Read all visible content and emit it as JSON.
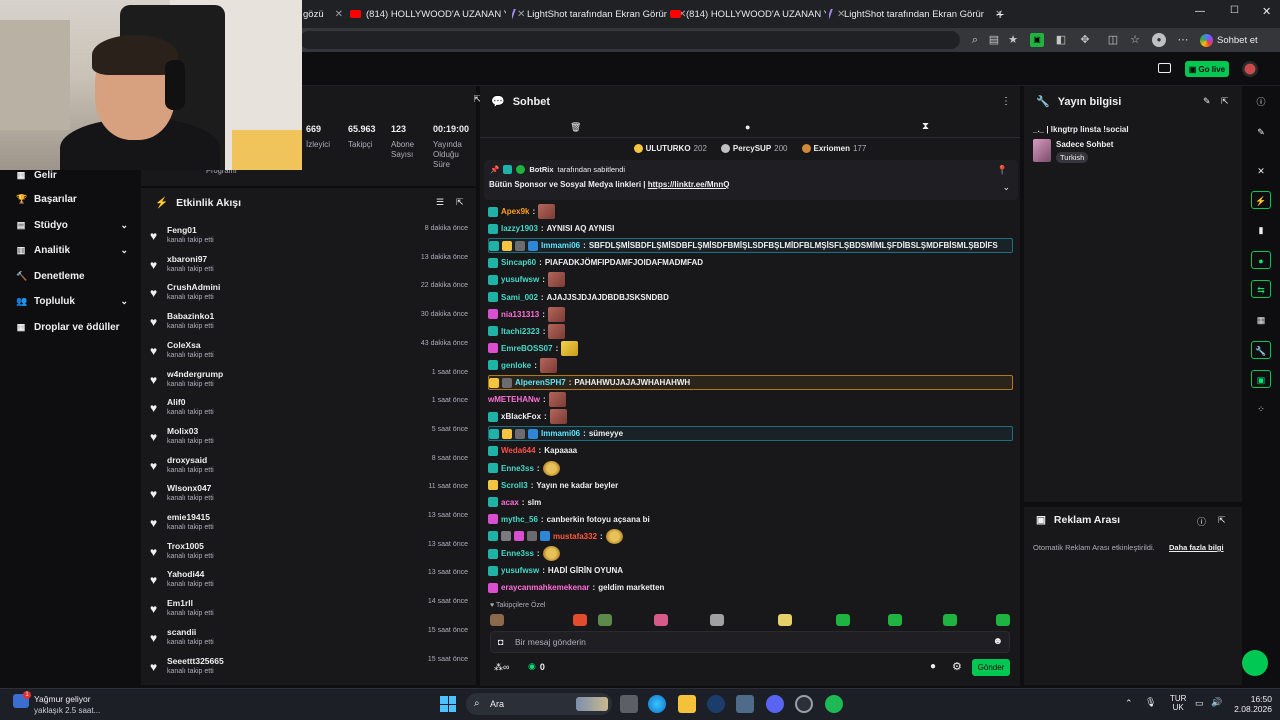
{
  "browser": {
    "tabs": [
      {
        "label": "gözü",
        "icon": "youtube-icon"
      },
      {
        "label": "(814) HOLLYWOOD'A UZANAN YO",
        "icon": "youtube-icon"
      },
      {
        "label": "LightShot tarafından Ekran Görün",
        "icon": "lightshot-icon"
      },
      {
        "label": "(814) HOLLYWOOD'A UZANAN YO",
        "icon": "youtube-icon"
      },
      {
        "label": "LightShot tarafından Ekran Görün",
        "icon": "lightshot-icon"
      }
    ],
    "sohbet_label": "Sohbet et"
  },
  "header": {
    "go_live_label": "Go live"
  },
  "left_nav": {
    "items": [
      {
        "label": "Gelir",
        "icon": "revenue-icon",
        "chevron": false
      },
      {
        "label": "Başarılar",
        "icon": "trophy-icon",
        "chevron": false
      },
      {
        "label": "Stüdyo",
        "icon": "studio-icon",
        "chevron": true
      },
      {
        "label": "Analitik",
        "icon": "analytics-icon",
        "chevron": true
      },
      {
        "label": "Denetleme",
        "icon": "moderation-icon",
        "chevron": false
      },
      {
        "label": "Topluluk",
        "icon": "community-icon",
        "chevron": true
      },
      {
        "label": "Droplar ve ödüller",
        "icon": "drops-icon",
        "chevron": false
      }
    ]
  },
  "stats": {
    "partial_label": "Programı",
    "items": [
      {
        "value": "669",
        "label": "İzleyici"
      },
      {
        "value": "65.963",
        "label": "Takipçi"
      },
      {
        "value": "123",
        "label": "Abone Sayısı"
      },
      {
        "value": "00:19:00",
        "label": "Yayında Olduğu Süre"
      }
    ]
  },
  "activity": {
    "title": "Etkinlik Akışı",
    "items": [
      {
        "user": "Feng01",
        "action": "kanalı takip etti",
        "time": "8 dakika önce"
      },
      {
        "user": "xbaroni97",
        "action": "kanalı takip etti",
        "time": "13 dakika önce"
      },
      {
        "user": "CrushAdmini",
        "action": "kanalı takip etti",
        "time": "22 dakika önce"
      },
      {
        "user": "Babazinko1",
        "action": "kanalı takip etti",
        "time": "30 dakika önce"
      },
      {
        "user": "ColeXsa",
        "action": "kanalı takip etti",
        "time": "43 dakika önce"
      },
      {
        "user": "w4ndergrump",
        "action": "kanalı takip etti",
        "time": "1 saat önce"
      },
      {
        "user": "Alif0",
        "action": "kanalı takip etti",
        "time": "1 saat önce"
      },
      {
        "user": "Molix03",
        "action": "kanalı takip etti",
        "time": "5 saat önce"
      },
      {
        "user": "droxysaid",
        "action": "kanalı takip etti",
        "time": "8 saat önce"
      },
      {
        "user": "Wlsonx047",
        "action": "kanalı takip etti",
        "time": "11 saat önce"
      },
      {
        "user": "emie19415",
        "action": "kanalı takip etti",
        "time": "13 saat önce"
      },
      {
        "user": "Trox1005",
        "action": "kanalı takip etti",
        "time": "13 saat önce"
      },
      {
        "user": "Yahodi44",
        "action": "kanalı takip etti",
        "time": "13 saat önce"
      },
      {
        "user": "Em1rll",
        "action": "kanalı takip etti",
        "time": "14 saat önce"
      },
      {
        "user": "scandii",
        "action": "kanalı takip etti",
        "time": "15 saat önce"
      },
      {
        "user": "Seeettt325665",
        "action": "kanalı takip etti",
        "time": "15 saat önce"
      }
    ]
  },
  "chat": {
    "title": "Sohbet",
    "leaderboard": [
      {
        "name": "ULUTURKO",
        "points": "202",
        "color": "#f5c542"
      },
      {
        "name": "PercySUP",
        "points": "200",
        "color": "#c0c0c0"
      },
      {
        "name": "Exriomen",
        "points": "177",
        "color": "#d08a3a"
      }
    ],
    "pinned": {
      "pinned_by": "BotRix",
      "pinned_suffix": "tarafından sabitlendi",
      "message": "Bütün Sponsor ve Sosyal Medya linkleri |",
      "link": "https://linktr.ee/MnnQ"
    },
    "messages": [
      {
        "user": "Apex9k",
        "color": "#ff9f1c",
        "text": "",
        "emote": "emote",
        "style": "",
        "badges": [
          "#1fb3a8"
        ]
      },
      {
        "user": "lazzy1903",
        "color": "#46d9c8",
        "text": "AYNISI AQ AYNISI",
        "emote": "",
        "style": "",
        "badges": [
          "#1fb3a8"
        ]
      },
      {
        "user": "Immami06",
        "color": "#5ee5ff",
        "text": "SBFDLŞMİSBDFLŞMİSDBFLŞMİSDFBMİŞLSDFBŞLMİDFBLMŞİSFLŞBDSMİMLŞFDİBSLŞMDFBİSMLŞBDİFS",
        "emote": "",
        "style": "hl-blue",
        "badges": [
          "#1fb3a8",
          "#f5c542",
          "#6b6b70",
          "#2f86d6"
        ]
      },
      {
        "user": "Sincap60",
        "color": "#46d9c8",
        "text": "PIAFADKJÖMFIPDAMFJOIDAFMADMFAD",
        "emote": "",
        "style": "",
        "badges": [
          "#1fb3a8"
        ]
      },
      {
        "user": "yusufwsw",
        "color": "#46d9c8",
        "text": "",
        "emote": "emote",
        "style": "",
        "badges": [
          "#1fb3a8"
        ]
      },
      {
        "user": "Sami_002",
        "color": "#46d9c8",
        "text": "AJAJJSJDJAJDBDBJSKSNDBD",
        "emote": "",
        "style": "",
        "badges": [
          "#1fb3a8"
        ]
      },
      {
        "user": "nia131313",
        "color": "#ff6fd8",
        "text": "",
        "emote": "emote",
        "style": "",
        "badges": [
          "#d94fd0"
        ]
      },
      {
        "user": "Itachi2323",
        "color": "#46d9c8",
        "text": "",
        "emote": "emote",
        "style": "",
        "badges": [
          "#1fb3a8"
        ]
      },
      {
        "user": "EmreBOSS07",
        "color": "#46d9c8",
        "text": "",
        "emote": "gold",
        "style": "",
        "badges": [
          "#d94fd0"
        ]
      },
      {
        "user": "genloke",
        "color": "#46d9c8",
        "text": "",
        "emote": "emote",
        "style": "",
        "badges": [
          "#1fb3a8"
        ]
      },
      {
        "user": "AlperenSPH7",
        "color": "#5ee5ff",
        "text": "PAHAHWUJAJAJWHAHAHWH",
        "emote": "",
        "style": "hl-gold",
        "badges": [
          "#f5c542",
          "#6b6b70"
        ]
      },
      {
        "user": "wMETEHANw",
        "color": "#ff6fd8",
        "text": "",
        "emote": "emote",
        "style": "",
        "badges": []
      },
      {
        "user": "xBlackFox",
        "color": "#efeff1",
        "text": "",
        "emote": "emote",
        "style": "",
        "badges": [
          "#1fb3a8"
        ]
      },
      {
        "user": "Immami06",
        "color": "#5ee5ff",
        "text": "sümeyye",
        "emote": "",
        "style": "hl-blue",
        "badges": [
          "#1fb3a8",
          "#f5c542",
          "#6b6b70",
          "#2f86d6"
        ]
      },
      {
        "user": "Weda644",
        "color": "#ff4d4d",
        "text": "Kapaaaa",
        "emote": "",
        "style": "",
        "badges": [
          "#1fb3a8"
        ]
      },
      {
        "user": "Enne3ss",
        "color": "#46d9c8",
        "text": "",
        "emote": "round",
        "style": "",
        "badges": [
          "#1fb3a8"
        ]
      },
      {
        "user": "Scroll3",
        "color": "#46d9c8",
        "text": "Yayın ne kadar beyler",
        "emote": "",
        "style": "",
        "badges": [
          "#f5c542"
        ]
      },
      {
        "user": "acax",
        "color": "#ff6fd8",
        "text": "slm",
        "emote": "",
        "style": "",
        "badges": [
          "#1fb3a8"
        ]
      },
      {
        "user": "mythc_56",
        "color": "#46d9c8",
        "text": "canberkin fotoyu açsana bi",
        "emote": "",
        "style": "",
        "badges": [
          "#d94fd0"
        ]
      },
      {
        "user": "mustafa332",
        "color": "#ff5a3d",
        "text": "",
        "emote": "round",
        "style": "",
        "badges": [
          "#1fb3a8",
          "#7a7a80",
          "#d94fd0",
          "#6b6b70",
          "#2f86d6"
        ]
      },
      {
        "user": "Enne3ss",
        "color": "#46d9c8",
        "text": "",
        "emote": "round",
        "style": "",
        "badges": [
          "#1fb3a8"
        ]
      },
      {
        "user": "yusufwsw",
        "color": "#46d9c8",
        "text": "HADİ GİRİN OYUNA",
        "emote": "",
        "style": "",
        "badges": [
          "#1fb3a8"
        ]
      },
      {
        "user": "eraycanmahkemekenar",
        "color": "#ff6fd8",
        "text": "geldim marketten",
        "emote": "",
        "style": "",
        "badges": [
          "#d94fd0"
        ]
      }
    ],
    "followers_only_label": "Takipçilere Özel",
    "input_placeholder": "Bir mesaj gönderin",
    "points_value": "0",
    "send_label": "Gönder"
  },
  "stream_info": {
    "title": "Yayın bilgisi",
    "stream_title": "_._ | lkngtrp linsta !social",
    "category": "Sadece Sohbet",
    "tag": "Turkish"
  },
  "ad_break": {
    "title": "Reklam Arası",
    "text": "Otomatik Reklam Arası etkinleştirildi.",
    "link": "Daha fazla bilgi"
  },
  "taskbar": {
    "weather_title": "Yağmur geliyor",
    "weather_sub": "yaklaşık 2.5 saat...",
    "weather_badge": "1",
    "search_label": "Ara",
    "lang_top": "TUR",
    "lang_bottom": "UK",
    "time": "16:50",
    "date": "2.08.2026"
  }
}
